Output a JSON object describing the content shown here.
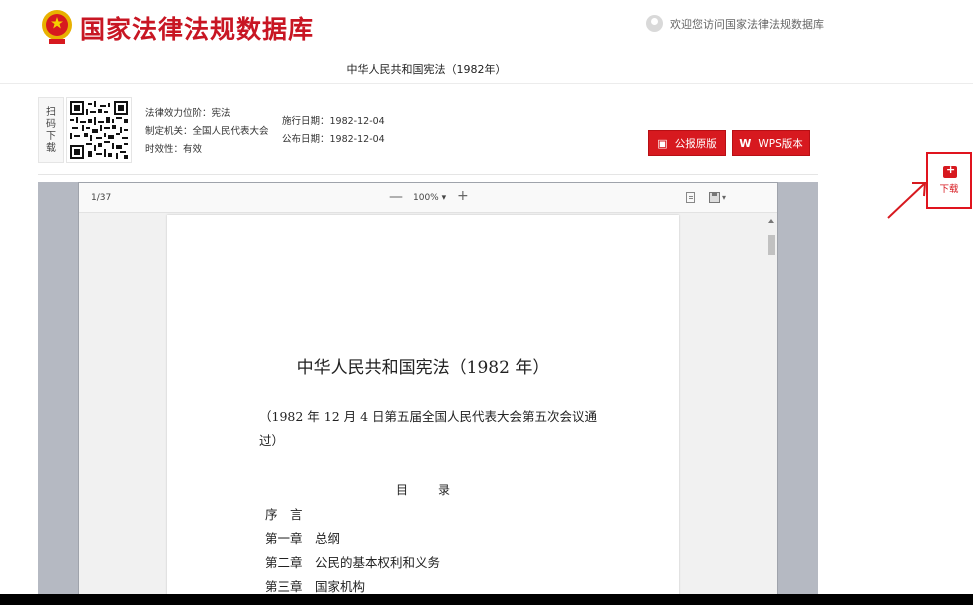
{
  "header": {
    "site_title": "国家法律法规数据库",
    "welcome": "欢迎您访问国家法律法规数据库",
    "doc_title": "中华人民共和国宪法（1982年）"
  },
  "meta": {
    "scan_label": "扫码下载",
    "legal_level": "法律效力位阶：宪法",
    "authority": "制定机关：全国人民代表大会",
    "validity": "时效性：有效",
    "effective_date": "施行日期：1982-12-04",
    "publish_date": "公布日期：1982-12-04"
  },
  "buttons": {
    "official": "公报原版",
    "wps": "WPS版本"
  },
  "viewer": {
    "page_count": "1/37",
    "zoom": "100% ▾",
    "zoom_out": "—",
    "zoom_in": "+"
  },
  "document": {
    "title": "中华人民共和国宪法（1982 年）",
    "subtitle": "（1982 年 12 月 4 日第五届全国人民代表大会第五次会议通过）",
    "toc_heading": "目录",
    "toc": [
      "序　言",
      "第一章　总纲",
      "第二章　公民的基本权利和义务",
      "第三章　国家机构"
    ]
  },
  "float": {
    "download_label": "下载"
  },
  "colors": {
    "brand_red": "#d7191f",
    "title_red": "#c81623"
  }
}
